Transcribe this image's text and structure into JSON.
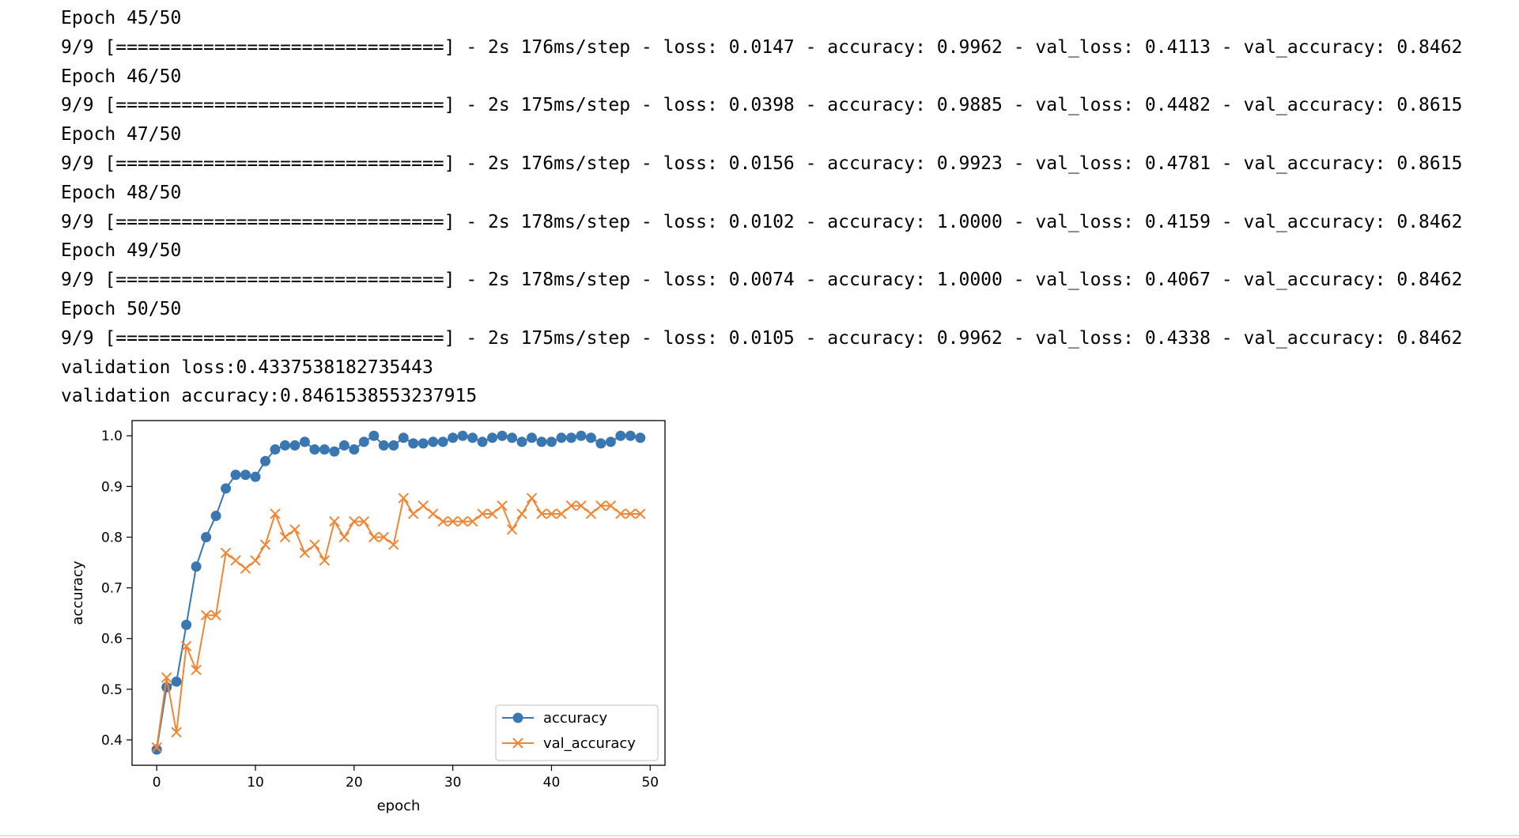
{
  "log": [
    "Epoch 45/50",
    "9/9 [==============================] - 2s 176ms/step - loss: 0.0147 - accuracy: 0.9962 - val_loss: 0.4113 - val_accuracy: 0.8462",
    "Epoch 46/50",
    "9/9 [==============================] - 2s 175ms/step - loss: 0.0398 - accuracy: 0.9885 - val_loss: 0.4482 - val_accuracy: 0.8615",
    "Epoch 47/50",
    "9/9 [==============================] - 2s 176ms/step - loss: 0.0156 - accuracy: 0.9923 - val_loss: 0.4781 - val_accuracy: 0.8615",
    "Epoch 48/50",
    "9/9 [==============================] - 2s 178ms/step - loss: 0.0102 - accuracy: 1.0000 - val_loss: 0.4159 - val_accuracy: 0.8462",
    "Epoch 49/50",
    "9/9 [==============================] - 2s 178ms/step - loss: 0.0074 - accuracy: 1.0000 - val_loss: 0.4067 - val_accuracy: 0.8462",
    "Epoch 50/50",
    "9/9 [==============================] - 2s 175ms/step - loss: 0.0105 - accuracy: 0.9962 - val_loss: 0.4338 - val_accuracy: 0.8462",
    "validation loss:0.4337538182735443",
    "validation accuracy:0.8461538553237915"
  ],
  "chart_data": {
    "type": "line",
    "xlabel": "epoch",
    "ylabel": "accuracy",
    "xlim": [
      -2.5,
      51.5
    ],
    "ylim": [
      0.35,
      1.03
    ],
    "xticks": [
      0,
      10,
      20,
      30,
      40,
      50
    ],
    "yticks": [
      0.4,
      0.5,
      0.6,
      0.7,
      0.8,
      0.9,
      1.0
    ],
    "ytick_labels": [
      "0.4",
      "0.5",
      "0.6",
      "0.7",
      "0.8",
      "0.9",
      "1.0"
    ],
    "grid": false,
    "legend_position": "lower-right",
    "x": [
      0,
      1,
      2,
      3,
      4,
      5,
      6,
      7,
      8,
      9,
      10,
      11,
      12,
      13,
      14,
      15,
      16,
      17,
      18,
      19,
      20,
      21,
      22,
      23,
      24,
      25,
      26,
      27,
      28,
      29,
      30,
      31,
      32,
      33,
      34,
      35,
      36,
      37,
      38,
      39,
      40,
      41,
      42,
      43,
      44,
      45,
      46,
      47,
      48,
      49
    ],
    "series": [
      {
        "name": "accuracy",
        "color": "#3a76af",
        "marker": "circle",
        "values": [
          0.381,
          0.504,
          0.515,
          0.627,
          0.742,
          0.8,
          0.842,
          0.896,
          0.923,
          0.923,
          0.919,
          0.95,
          0.973,
          0.981,
          0.981,
          0.988,
          0.973,
          0.973,
          0.969,
          0.981,
          0.973,
          0.988,
          1.0,
          0.981,
          0.981,
          0.996,
          0.985,
          0.985,
          0.988,
          0.988,
          0.996,
          1.0,
          0.996,
          0.988,
          0.996,
          1.0,
          0.996,
          0.988,
          0.996,
          0.988,
          0.988,
          0.996,
          0.996,
          1.0,
          0.996,
          0.985,
          0.988,
          1.0,
          1.0,
          0.996
        ]
      },
      {
        "name": "val_accuracy",
        "color": "#ef8636",
        "marker": "x",
        "values": [
          0.385,
          0.523,
          0.415,
          0.585,
          0.538,
          0.646,
          0.646,
          0.769,
          0.754,
          0.738,
          0.754,
          0.785,
          0.846,
          0.8,
          0.815,
          0.769,
          0.785,
          0.754,
          0.831,
          0.8,
          0.831,
          0.831,
          0.8,
          0.8,
          0.785,
          0.877,
          0.846,
          0.862,
          0.846,
          0.831,
          0.831,
          0.831,
          0.831,
          0.846,
          0.846,
          0.862,
          0.815,
          0.846,
          0.877,
          0.846,
          0.846,
          0.846,
          0.862,
          0.862,
          0.846,
          0.862,
          0.862,
          0.846,
          0.846,
          0.846
        ]
      }
    ]
  }
}
